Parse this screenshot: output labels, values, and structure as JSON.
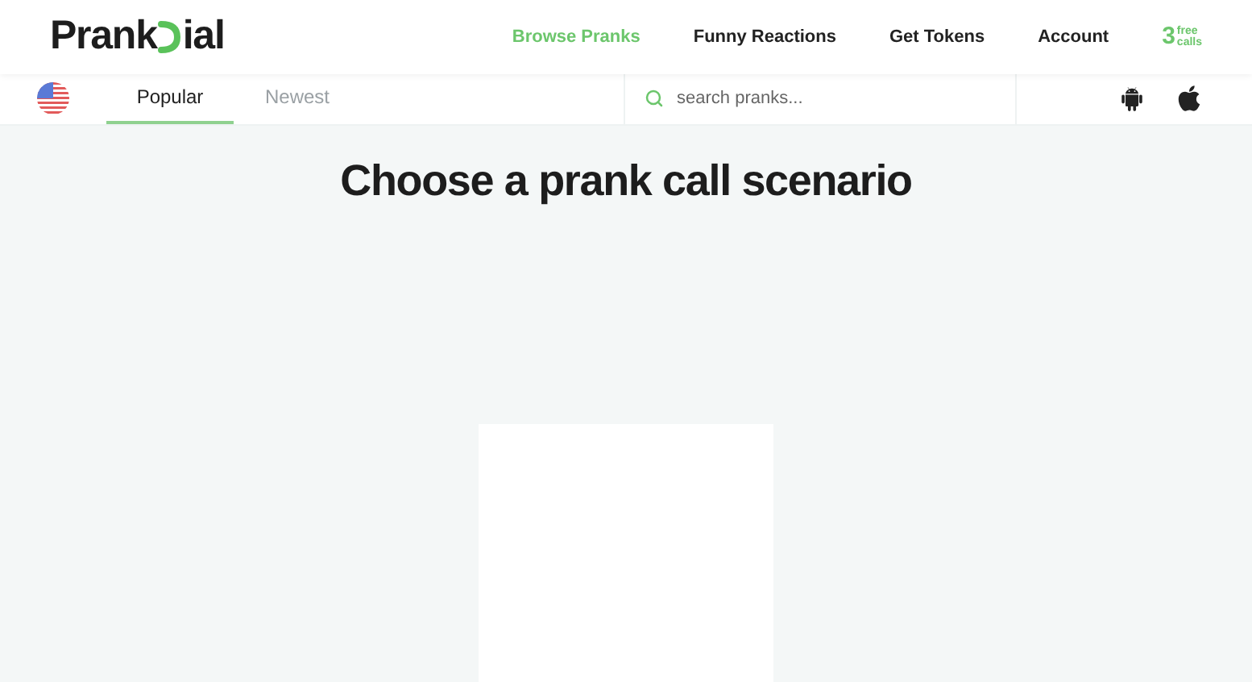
{
  "logo": {
    "start": "Prank",
    "end": "ial"
  },
  "nav": [
    {
      "label": "Browse Pranks",
      "selected": true
    },
    {
      "label": "Funny Reactions",
      "selected": false
    },
    {
      "label": "Get Tokens",
      "selected": false
    },
    {
      "label": "Account",
      "selected": false
    }
  ],
  "free_calls": {
    "count": "3",
    "line1": "free",
    "line2": "calls"
  },
  "tabs": [
    {
      "label": "Popular",
      "selected": true
    },
    {
      "label": "Newest",
      "selected": false
    }
  ],
  "search": {
    "placeholder": "search pranks..."
  },
  "heading": "Choose a prank call scenario"
}
